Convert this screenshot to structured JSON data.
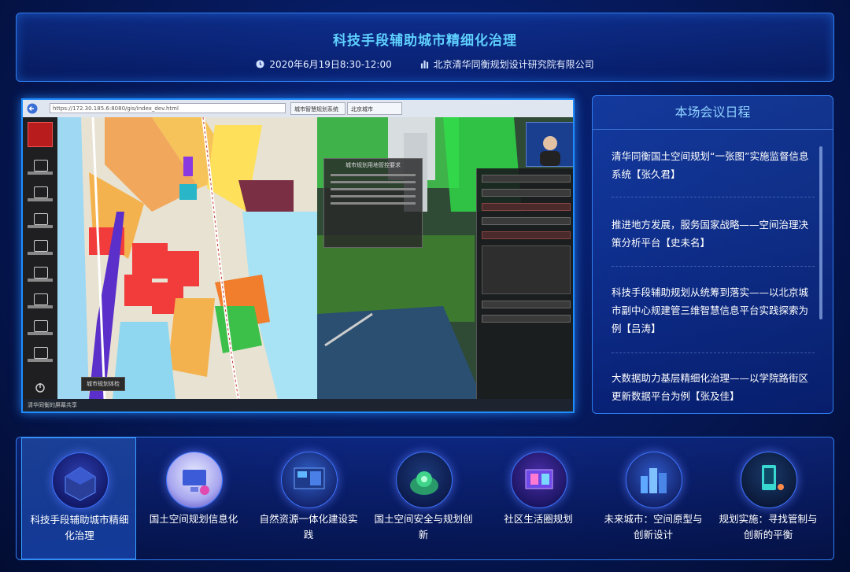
{
  "header": {
    "title": "科技手段辅助城市精细化治理",
    "datetime": "2020年6月19日8:30-12:00",
    "organizer": "北京清华同衡规划设计研究院有限公司",
    "clock_icon": "clock-icon",
    "building_icon": "building-icon"
  },
  "video": {
    "url": "https://172.30.185.6:8080/gis/index_dev.html",
    "tabs": [
      "城市智慧规划系统",
      "北京城市"
    ],
    "map_label": "城市规划体检",
    "overlay_title": "城市规划用地管控要求",
    "taskbar_label": "清华同衡的屏幕共享"
  },
  "agenda": {
    "title": "本场会议日程",
    "items": [
      "清华同衡国土空间规划“一张图”实施监督信息系统【张久君】",
      "推进地方发展，服务国家战略——空间治理决策分析平台【史未名】",
      "科技手段辅助规划从统筹到落实——以北京城市副中心规建管三维智慧信息平台实践探索为例【吕涛】",
      "大数据助力基层精细化治理——以学院路街区更新数据平台为例【张及佳】"
    ]
  },
  "nav": {
    "items": [
      {
        "label": "科技手段辅助城市精细化治理",
        "active": true,
        "icon": "smart-city-cube-icon"
      },
      {
        "label": "国土空间规划信息化",
        "active": false,
        "icon": "computer-workstation-icon"
      },
      {
        "label": "自然资源一体化建设实践",
        "active": false,
        "icon": "data-screen-icon"
      },
      {
        "label": "国土空间安全与规划创新",
        "active": false,
        "icon": "earth-globe-icon"
      },
      {
        "label": "社区生活圈规划",
        "active": false,
        "icon": "community-monitor-icon"
      },
      {
        "label": "未来城市：空间原型与创新设计",
        "active": false,
        "icon": "future-city-icon"
      },
      {
        "label": "规划实施：寻找管制与创新的平衡",
        "active": false,
        "icon": "mobile-planning-icon"
      }
    ]
  },
  "colors": {
    "accent": "#5fd1ff",
    "border": "#2f7df0",
    "background": "#061a5e"
  }
}
